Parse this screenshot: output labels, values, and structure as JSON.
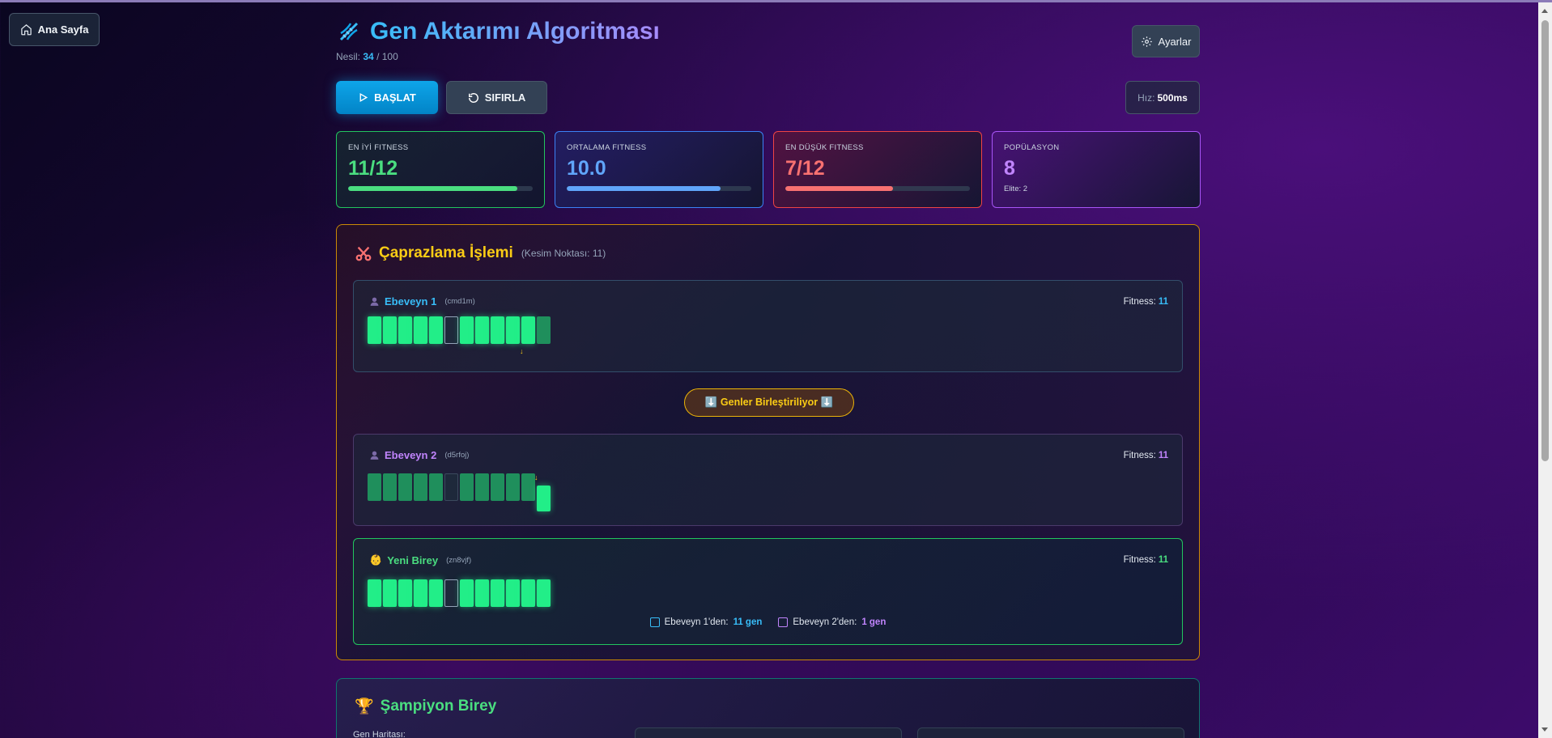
{
  "nav": {
    "home_label": "Ana Sayfa"
  },
  "header": {
    "title": "Gen Aktarımı Algoritması",
    "generation_prefix": "Nesil:",
    "generation_current": "34",
    "generation_total": "/ 100",
    "settings_label": "Ayarlar"
  },
  "controls": {
    "start_label": "BAŞLAT",
    "reset_label": "SIFIRLA",
    "speed_label": "Hız:",
    "speed_value": "500ms"
  },
  "stats": {
    "best": {
      "label": "EN İYİ FITNESS",
      "value": "11/12",
      "progress": 0.917
    },
    "avg": {
      "label": "ORTALAMA FITNESS",
      "value": "10.0",
      "progress": 0.833
    },
    "worst": {
      "label": "EN DÜŞÜK FITNESS",
      "value": "7/12",
      "progress": 0.583
    },
    "population": {
      "label": "POPÜLASYON",
      "value": "8",
      "elite": "Elite: 2"
    }
  },
  "crossover": {
    "title": "Çaprazlama İşlemi",
    "cut_note": "(Kesim Noktası: 11)",
    "merge_label": "⬇️ Genler Birleştiriliyor ⬇️",
    "parent1": {
      "name": "Ebeveyn 1",
      "id": "(cmd1m)",
      "fitness_label": "Fitness:",
      "fitness": "11",
      "genes": [
        1,
        1,
        1,
        1,
        1,
        0,
        1,
        1,
        1,
        1,
        1,
        1
      ]
    },
    "parent2": {
      "name": "Ebeveyn 2",
      "id": "(d5rfoj)",
      "fitness_label": "Fitness:",
      "fitness": "11",
      "genes": [
        1,
        1,
        1,
        1,
        1,
        0,
        1,
        1,
        1,
        1,
        1,
        1
      ]
    },
    "child": {
      "name": "Yeni Birey",
      "id": "(zn8vjf)",
      "fitness_label": "Fitness:",
      "fitness": "11",
      "genes": [
        1,
        1,
        1,
        1,
        1,
        0,
        1,
        1,
        1,
        1,
        1,
        1
      ],
      "from_parent1_label": "Ebeveyn 1'den:",
      "from_parent1": "11 gen",
      "from_parent2_label": "Ebeveyn 2'den:",
      "from_parent2": "1 gen"
    },
    "cut_marker": "↓"
  },
  "champion": {
    "title": "Şampiyon Birey",
    "gene_map_label": "Gen Haritası:"
  },
  "colors": {
    "accent": "#38bdf8",
    "gene_on": "#22ee88",
    "warning": "#facc15",
    "parent1": "#38bdf8",
    "parent2": "#c084fc",
    "child": "#4ade80"
  }
}
